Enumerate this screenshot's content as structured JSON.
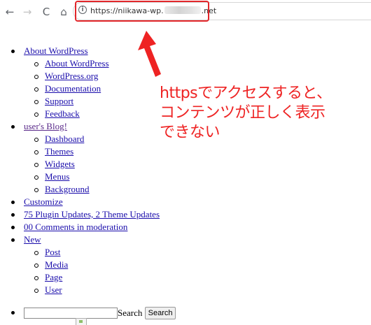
{
  "browser": {
    "back_glyph": "←",
    "forward_glyph": "→",
    "reload_glyph": "C",
    "home_glyph": "⌂",
    "info_glyph": "i",
    "url_prefix": "https://niikawa-wp.",
    "url_suffix": ".net"
  },
  "menu": {
    "about": {
      "label": "About WordPress",
      "items": [
        "About WordPress",
        "WordPress.org",
        "Documentation",
        "Support",
        "Feedback"
      ]
    },
    "site": {
      "label": "user's Blog!",
      "items": [
        "Dashboard",
        "Themes",
        "Widgets",
        "Menus",
        "Background"
      ]
    },
    "customize": "Customize",
    "updates": "75 Plugin Updates, 2 Theme Updates",
    "comments": "00 Comments in moderation",
    "new": {
      "label": "New",
      "items": [
        "Post",
        "Media",
        "Page",
        "User"
      ]
    }
  },
  "search": {
    "value": "",
    "label": "Search",
    "button_label": "Search"
  },
  "annotation": {
    "line1": "httpsでアクセスすると、",
    "line2": "コンテンツが正しく表示",
    "line3": "できない",
    "color": "#ee2323"
  }
}
